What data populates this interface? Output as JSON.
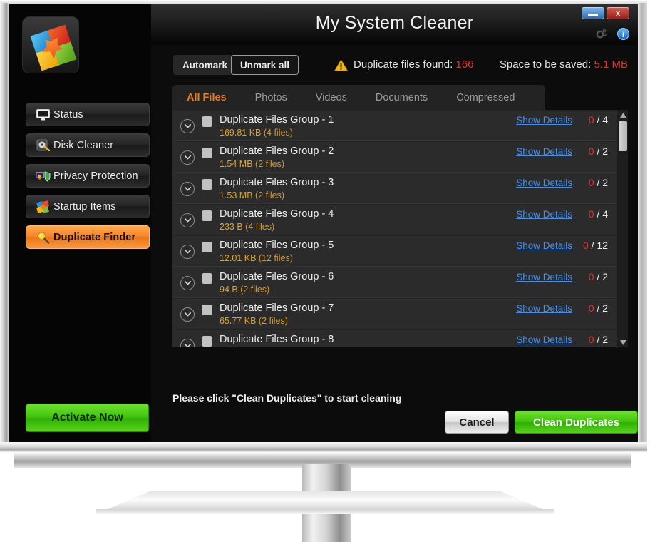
{
  "window": {
    "title": "My System Cleaner",
    "minimize_label": "",
    "close_label": "x"
  },
  "sidebar": {
    "logo_name": "app-logo",
    "items": [
      {
        "label": "Status",
        "icon": "monitor-icon",
        "active": false
      },
      {
        "label": "Disk Cleaner",
        "icon": "disk-icon",
        "active": false
      },
      {
        "label": "Privacy Protection",
        "icon": "shield-icon",
        "active": false
      },
      {
        "label": "Startup Items",
        "icon": "startup-icon",
        "active": false
      },
      {
        "label": "Duplicate Finder",
        "icon": "magnifier-icon",
        "active": true
      }
    ],
    "activate_label": "Activate Now"
  },
  "toolbar": {
    "automark_label": "Automark",
    "unmark_all_label": "Unmark all",
    "warning_icon": "warning-triangle-icon",
    "duplicates_found_label": "Duplicate files found:",
    "duplicates_found_value": "166",
    "space_saved_label": "Space to be saved:",
    "space_saved_value": "5.1 MB",
    "gear_icon": "gear-icon",
    "info_icon": "info-icon",
    "info_glyph": "i"
  },
  "tabs": [
    {
      "label": "All Files",
      "active": true
    },
    {
      "label": "Photos",
      "active": false
    },
    {
      "label": "Videos",
      "active": false
    },
    {
      "label": "Documents",
      "active": false
    },
    {
      "label": "Compressed",
      "active": false
    }
  ],
  "list": {
    "details_label": "Show Details",
    "rows": [
      {
        "title": "Duplicate Files Group - 1",
        "size": "169.81 KB",
        "files": "(4 files)",
        "marked": "0",
        "total": "/ 4"
      },
      {
        "title": "Duplicate Files Group - 2",
        "size": "1.54 MB",
        "files": "(2 files)",
        "marked": "0",
        "total": "/ 2"
      },
      {
        "title": "Duplicate Files Group - 3",
        "size": "1.53 MB",
        "files": "(2 files)",
        "marked": "0",
        "total": "/ 2"
      },
      {
        "title": "Duplicate Files Group - 4",
        "size": "233 B",
        "files": "(4 files)",
        "marked": "0",
        "total": "/ 4"
      },
      {
        "title": "Duplicate Files Group - 5",
        "size": "12.01 KB",
        "files": "(12 files)",
        "marked": "0",
        "total": "/ 12"
      },
      {
        "title": "Duplicate Files Group - 6",
        "size": "94 B",
        "files": "(2 files)",
        "marked": "0",
        "total": "/ 2"
      },
      {
        "title": "Duplicate Files Group - 7",
        "size": "65.77 KB",
        "files": "(2 files)",
        "marked": "0",
        "total": "/ 2"
      },
      {
        "title": "Duplicate Files Group - 8",
        "size": "",
        "files": "",
        "marked": "0",
        "total": "/ 2"
      }
    ]
  },
  "footer": {
    "hint": "Please click \"Clean Duplicates\" to start cleaning",
    "cancel_label": "Cancel",
    "clean_label": "Clean Duplicates"
  },
  "colors": {
    "accent_orange": "#e87b1e",
    "alert_red": "#e03232",
    "size_yellow": "#e8a40d",
    "link_blue": "#4a90e2",
    "action_green": "#3fc40a"
  }
}
